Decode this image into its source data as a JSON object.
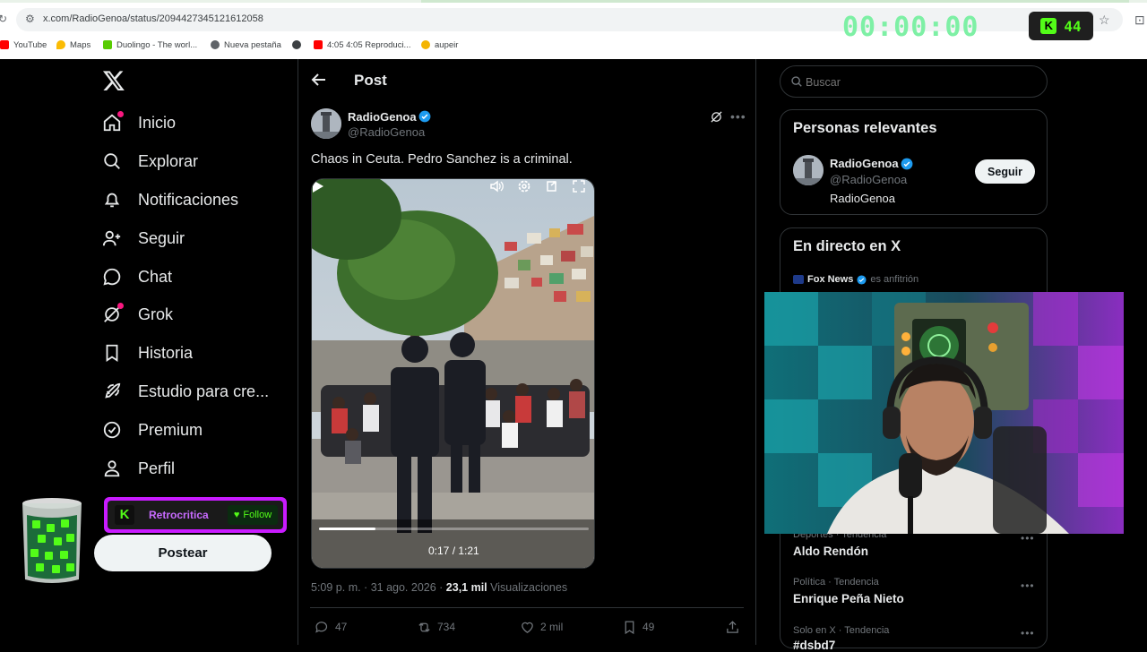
{
  "browser": {
    "url": "x.com/RadioGenoa/status/2094427345121612058",
    "bookmarks": [
      "YouTube",
      "Maps",
      "Duolingo - The worl...",
      "Nueva pestaña",
      "4:05 4:05 Reproduci...",
      "aupeir"
    ],
    "timer": "00:00:00",
    "kick_count": "44"
  },
  "nav": {
    "items": [
      {
        "label": "Inicio",
        "icon": "home-icon"
      },
      {
        "label": "Explorar",
        "icon": "search-icon"
      },
      {
        "label": "Notificaciones",
        "icon": "bell-icon"
      },
      {
        "label": "Seguir",
        "icon": "add-user-icon"
      },
      {
        "label": "Chat",
        "icon": "chat-icon"
      },
      {
        "label": "Grok",
        "icon": "grok-icon"
      },
      {
        "label": "Historia",
        "icon": "bookmark-icon"
      },
      {
        "label": "Estudio para cre...",
        "icon": "rocket-icon"
      },
      {
        "label": "Premium",
        "icon": "verified-icon"
      },
      {
        "label": "Perfil",
        "icon": "person-icon"
      }
    ],
    "post_button": "Postear"
  },
  "kick_overlay": {
    "channel": "Retrocritica",
    "follow": "Follow"
  },
  "post": {
    "header_title": "Post",
    "author_name": "RadioGenoa",
    "author_handle": "@RadioGenoa",
    "text": "Chaos in Ceuta. Pedro Sanchez is a criminal.",
    "video_time": "0:17 / 1:21",
    "video_progress": 0.21,
    "meta_time": "5:09 p. m. · 31 ago. 2026 · ",
    "meta_views_count": "23,1 mil",
    "meta_views_label": " Visualizaciones",
    "actions": {
      "replies": "47",
      "reposts": "734",
      "likes": "2 mil",
      "bookmarks": "49"
    }
  },
  "sidebar": {
    "search_placeholder": "Buscar",
    "relevant_title": "Personas relevantes",
    "relevant_name": "RadioGenoa",
    "relevant_handle": "@RadioGenoa",
    "relevant_bio": "RadioGenoa",
    "follow_label": "Seguir",
    "live_title": "En directo en X",
    "live_host_name": "Fox News",
    "live_host_suffix": "es anfitrión",
    "trends": [
      {
        "category": "Deportes · Tendencia",
        "name": "Aldo Rendón"
      },
      {
        "category": "Política · Tendencia",
        "name": "Enrique Peña Nieto"
      },
      {
        "category": "Solo en X · Tendencia",
        "name": "#dsbd7"
      }
    ]
  },
  "colors": {
    "accent_blue": "#1d9bf0",
    "kick_green": "#53fc18",
    "kick_purple": "#c91bff",
    "timer_green": "#7ef0a5"
  }
}
